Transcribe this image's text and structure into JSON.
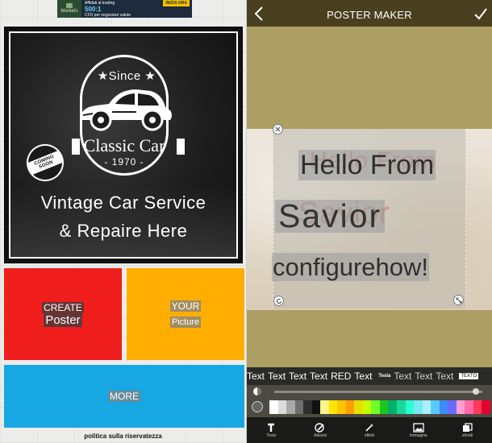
{
  "left_app": {
    "ad": {
      "brand": "Markets",
      "headline": "Affidati al trading",
      "subline": "CFD per negoziare valute",
      "big_value": "500:1",
      "cta": "INIZIA ORA"
    },
    "poster": {
      "since_label": "★Since ★",
      "ribbon_text": "Classic Car",
      "year": "- 1970 -",
      "coming_soon": "COMING SOON",
      "headline_1": "Vintage Car Service",
      "headline_2": "& Repaire Here"
    },
    "tiles": {
      "create_line1": "CREATE",
      "create_line2": "Poster",
      "your_line1": "YOUR",
      "your_line2": "Picture",
      "more": "MORE"
    },
    "privacy_link": "politica sulla riservatezza"
  },
  "right_app": {
    "header": {
      "title": "POSTER MAKER",
      "back_icon": "chevron-left-icon",
      "confirm_icon": "checkmark-icon"
    },
    "canvas_text": {
      "line_1": "Hello From",
      "line_2": "Savior",
      "line_3": "configurehow!"
    },
    "style_presets": [
      "Text",
      "Text",
      "Text",
      "Text",
      "RED",
      "Text",
      "Tesla",
      "Text",
      "Text",
      "Text",
      "TEXTO"
    ],
    "color_palette": [
      "#ffffff",
      "#dcdcdc",
      "#a9a9a9",
      "#6e6e6e",
      "#2e2e2e",
      "#111111",
      "#fff48a",
      "#ffe600",
      "#ffc300",
      "#ff9d00",
      "#e6e000",
      "#c8ff00",
      "#6dff2a",
      "#1ec51e",
      "#00b36b",
      "#19d99a",
      "#2affd4",
      "#79e9f2",
      "#a8f0ff",
      "#58c8ff",
      "#3a8dff",
      "#6a6aff",
      "#ff9fd1",
      "#ff6aa8",
      "#ff3b5c",
      "#e8002d"
    ],
    "opacity_percent": 97,
    "toolbar": [
      {
        "icon": "text-icon",
        "label": "Testo"
      },
      {
        "icon": "brush-icon",
        "label": "Adesivi"
      },
      {
        "icon": "magic-wand-icon",
        "label": "effetti"
      },
      {
        "icon": "image-icon",
        "label": "Immagine"
      },
      {
        "icon": "layers-icon",
        "label": "sfondi"
      }
    ]
  }
}
